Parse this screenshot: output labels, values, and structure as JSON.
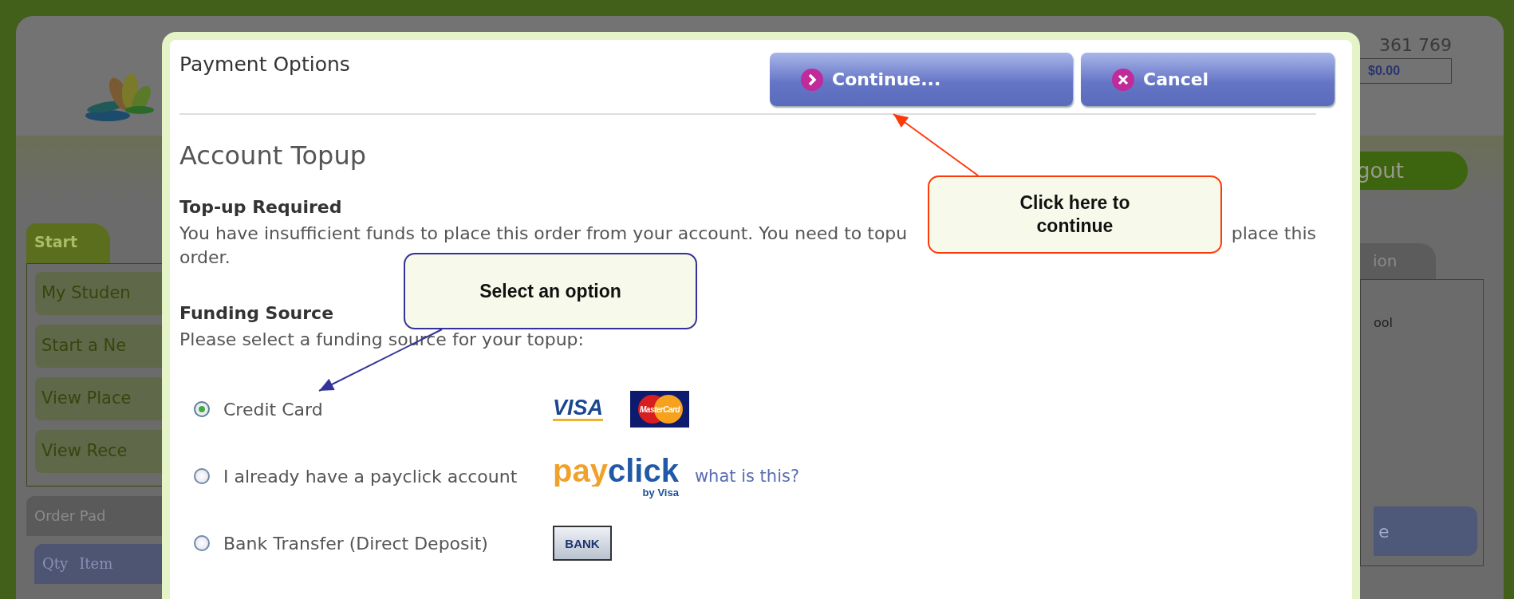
{
  "background": {
    "phone": "361 769",
    "balance": "$0.00",
    "logout": "gout",
    "start_tab": "Start",
    "menu": [
      "My Studen",
      "Start a Ne",
      "View Place",
      "View Rece"
    ],
    "order_pad": "Order Pad",
    "columns": [
      "Qty",
      "Item"
    ],
    "right_tab": "ion",
    "right_text": "ool",
    "right_button": "e"
  },
  "dialog": {
    "title": "Payment Options",
    "buttons": [
      {
        "kind": "continue",
        "label": "Continue..."
      },
      {
        "kind": "cancel",
        "label": "Cancel"
      }
    ],
    "heading": "Account Topup",
    "topup": {
      "title": "Top-up Required",
      "line_left": "You have insufficient funds to place this order from your account. You need to topu",
      "line_right": "place this",
      "line_2": "order."
    },
    "funding": {
      "title": "Funding Source",
      "prompt": "Please select a funding source for your topup:"
    },
    "options": [
      {
        "label": "Credit Card",
        "selected": true,
        "logos": [
          {
            "kind": "visa",
            "text": "VISA"
          },
          {
            "kind": "mastercard",
            "text": "MasterCard"
          }
        ]
      },
      {
        "label": "I already have a payclick account",
        "selected": false,
        "logos": [
          {
            "kind": "payclick",
            "text": "payclick",
            "subtext": "by Visa"
          }
        ],
        "link": "what is this?"
      },
      {
        "label": "Bank Transfer (Direct Deposit)",
        "selected": false,
        "logos": [
          {
            "kind": "bank",
            "text": "BANK"
          }
        ]
      }
    ]
  },
  "callouts": [
    {
      "kind": "red",
      "text": "Click here to continue"
    },
    {
      "kind": "navy",
      "text": "Select an option"
    }
  ]
}
